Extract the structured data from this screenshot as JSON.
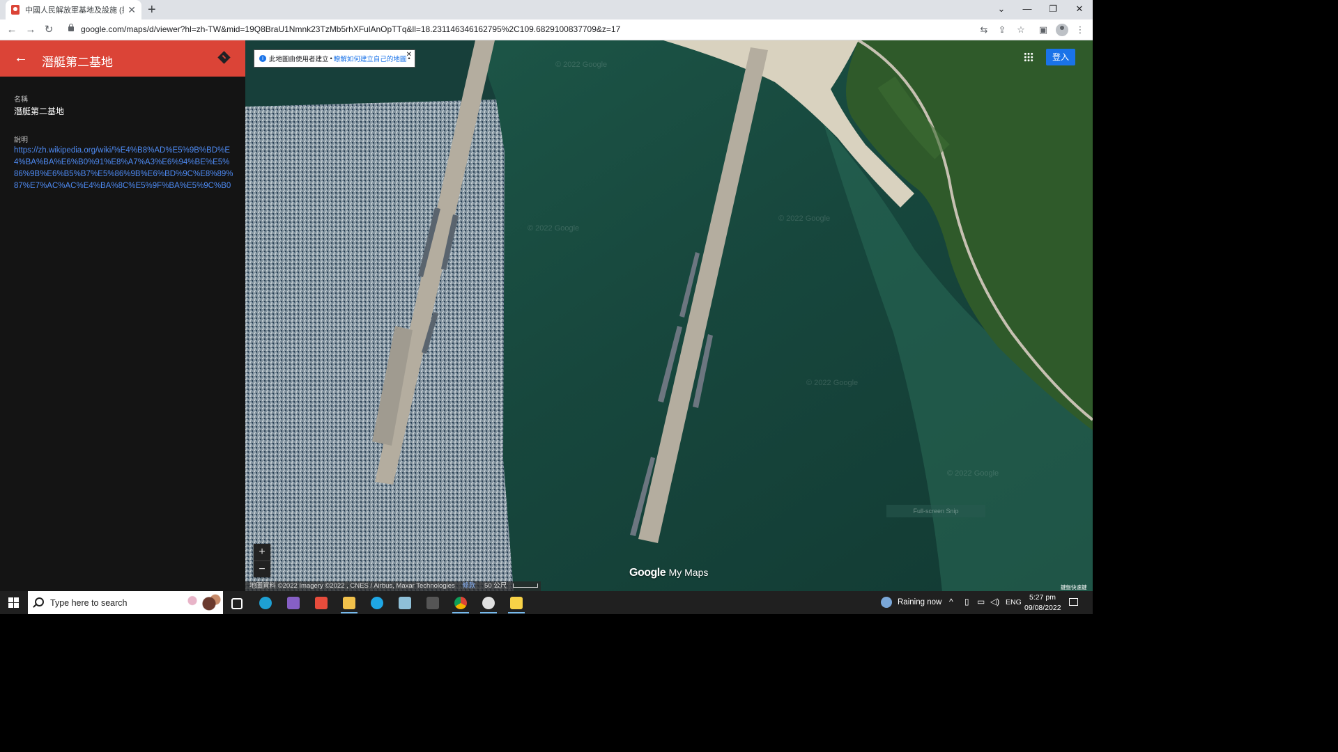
{
  "browser": {
    "tab_title": "中國人民解放軍基地及設施 (持續",
    "url": "google.com/maps/d/viewer?hl=zh-TW&mid=19Q8BraU1Nmnk23TzMb5rhXFulAnOpTTq&ll=18.231146346162795%2C109.6829100837709&z=17"
  },
  "sidebar": {
    "title": "潛艇第二基地",
    "name_label": "名稱",
    "name_value": "潛艇第二基地",
    "desc_label": "說明",
    "desc_link": "https://zh.wikipedia.org/wiki/%E4%B8%AD%E5%9B%BD%E4%BA%BA%E6%B0%91%E8%A7%A3%E6%94%BE%E5%86%9B%E6%B5%B7%E5%86%9B%E6%BD%9C%E8%89%87%E7%AC%AC%E4%BA%8C%E5%9F%BA%E5%9C%B0"
  },
  "map": {
    "info_text": "此地圖由使用者建立",
    "info_link": "瞭解如何建立自己的地圖",
    "signin_label": "登入",
    "zoom_in": "+",
    "zoom_out": "−",
    "logo_google": "Google",
    "logo_mymaps": "My Maps",
    "attribution": "地圖資料 ©2022 Imagery ©2022 , CNES / Airbus, Maxar Technologies",
    "terms": "條款",
    "scale": "50 公尺",
    "shortcuts": "鍵盤快速鍵",
    "fullscreen_snip": "Full-screen Snip",
    "watermark": "© 2022 Google"
  },
  "taskbar": {
    "search_placeholder": "Type here to search",
    "weather": "Raining now",
    "lang": "ENG",
    "time": "5:27 pm",
    "date": "09/08/2022"
  }
}
